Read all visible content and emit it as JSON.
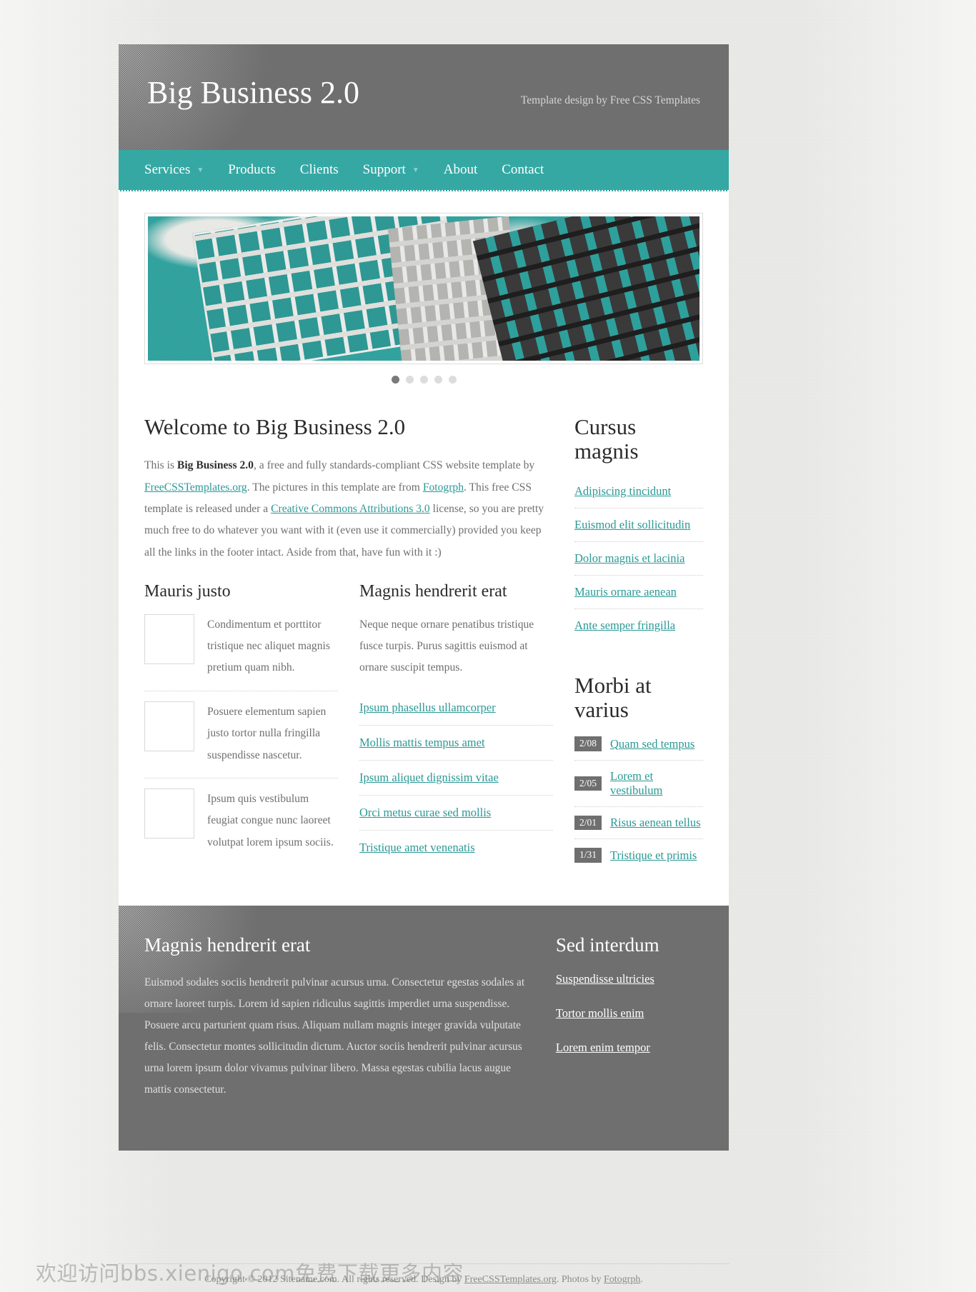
{
  "header": {
    "logo": "Big Business 2.0",
    "credit": "Template design by Free CSS Templates"
  },
  "menu": {
    "items": [
      {
        "label": "Services",
        "has_dropdown": true
      },
      {
        "label": "Products",
        "has_dropdown": false
      },
      {
        "label": "Clients",
        "has_dropdown": false
      },
      {
        "label": "Support",
        "has_dropdown": true
      },
      {
        "label": "About",
        "has_dropdown": false
      },
      {
        "label": "Contact",
        "has_dropdown": false
      }
    ]
  },
  "banner": {
    "image_alt": "Teal-tinted photograph of a curved office building facade against a cloudy sky",
    "dots": [
      {
        "active": true
      },
      {
        "active": false
      },
      {
        "active": false
      },
      {
        "active": false
      },
      {
        "active": false
      }
    ]
  },
  "content": {
    "welcome": {
      "title": "Welcome to Big Business 2.0",
      "paragraph": {
        "p1": "This is ",
        "strong1": "Big Business 2.0",
        "p2": ", a free and fully standards-compliant CSS website template by ",
        "link1": "FreeCSSTemplates.org",
        "p3": ". The pictures in this template are from ",
        "link2": "Fotogrph",
        "p4": ". This free CSS template is released under a ",
        "link3": "Creative Commons Attributions 3.0",
        "p5": " license, so you are pretty much free to do whatever you want with it (even use it commercially) provided you keep all the links in the footer intact. Aside from that, have fun with it :)"
      }
    },
    "mauris": {
      "title": "Mauris justo",
      "items": [
        {
          "text": "Condimentum et porttitor tristique nec aliquet magnis pretium quam nibh.",
          "thumb": "building-thumbnail-1"
        },
        {
          "text": "Posuere elementum sapien justo tortor nulla fringilla suspendisse nascetur.",
          "thumb": "building-thumbnail-2"
        },
        {
          "text": "Ipsum quis vestibulum feugiat congue nunc laoreet volutpat lorem ipsum sociis.",
          "thumb": "building-thumbnail-3"
        }
      ]
    },
    "magnis": {
      "title": "Magnis hendrerit erat",
      "intro": "Neque neque ornare penatibus tristique fusce turpis. Purus sagittis euismod at ornare suscipit tempus.",
      "links": [
        "Ipsum phasellus ullamcorper",
        "Mollis mattis tempus amet",
        "Ipsum aliquet dignissim vitae",
        "Orci metus curae sed mollis",
        "Tristique amet venenatis"
      ]
    }
  },
  "sidebar": {
    "cursus": {
      "title": "Cursus magnis",
      "links": [
        "Adipiscing tincidunt",
        "Euismod elit sollicitudin",
        "Dolor magnis et lacinia",
        "Mauris ornare aenean",
        "Ante semper fringilla"
      ]
    },
    "morbi": {
      "title": "Morbi at varius",
      "entries": [
        {
          "date": "2/08",
          "label": "Quam sed tempus"
        },
        {
          "date": "2/05",
          "label": "Lorem et vestibulum"
        },
        {
          "date": "2/01",
          "label": "Risus aenean tellus"
        },
        {
          "date": "1/31",
          "label": "Tristique et primis"
        }
      ]
    }
  },
  "footer": {
    "left": {
      "title": "Magnis hendrerit erat",
      "text": "Euismod sodales sociis hendrerit pulvinar acursus urna. Consectetur egestas sodales at ornare laoreet turpis. Lorem id sapien ridiculus sagittis imperdiet urna suspendisse. Posuere arcu parturient quam risus. Aliquam nullam magnis integer gravida vulputate felis. Consectetur montes sollicitudin dictum. Auctor sociis hendrerit pulvinar acursus urna lorem ipsum dolor vivamus pulvinar libero. Massa egestas cubilia lacus augue mattis consectetur."
    },
    "right": {
      "title": "Sed interdum",
      "links": [
        "Suspendisse ultricies",
        "Tortor mollis enim",
        "Lorem enim tempor"
      ]
    }
  },
  "copyright": {
    "part1": "Copyright © 2012 Sitename.com. All rights reserved. Design by ",
    "link1": "FreeCSSTemplates.org",
    "part2": ". Photos by ",
    "link2": "Fotogrph",
    "part3": "."
  },
  "watermark": {
    "text": "欢迎访问bbs.xienigo.com免费下载更多内容"
  },
  "colors": {
    "accent": "#35a8a4",
    "link": "#2a9995",
    "header_bg": "#706f6f",
    "body_text": "#6f6f6f",
    "heading": "#2b2b2b"
  }
}
